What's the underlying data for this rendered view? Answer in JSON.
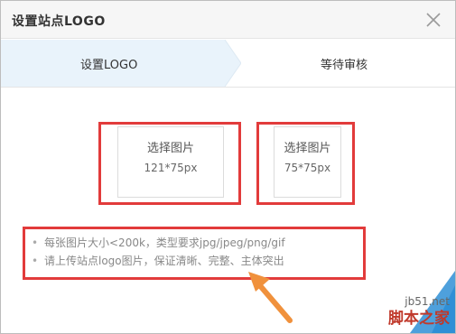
{
  "dialog": {
    "title": "设置站点LOGO",
    "close_icon": "close-icon"
  },
  "steps": [
    {
      "label": "设置LOGO",
      "active": true
    },
    {
      "label": "等待审核",
      "active": false
    }
  ],
  "uploads": [
    {
      "label": "选择图片",
      "size": "121*75px"
    },
    {
      "label": "选择图片",
      "size": "75*75px"
    }
  ],
  "hints": [
    "每张图片大小<200k，类型要求jpg/jpeg/png/gif",
    "请上传站点logo图片，保证清晰、完整、主体突出"
  ],
  "watermark": {
    "site": "jb51.net",
    "name": "脚本之家"
  },
  "colors": {
    "step_active_bg": "#e9f3fb",
    "annotation_red": "#e23b3b",
    "arrow_orange": "#f0913c",
    "watermark_blue": "#2f8fd6"
  }
}
